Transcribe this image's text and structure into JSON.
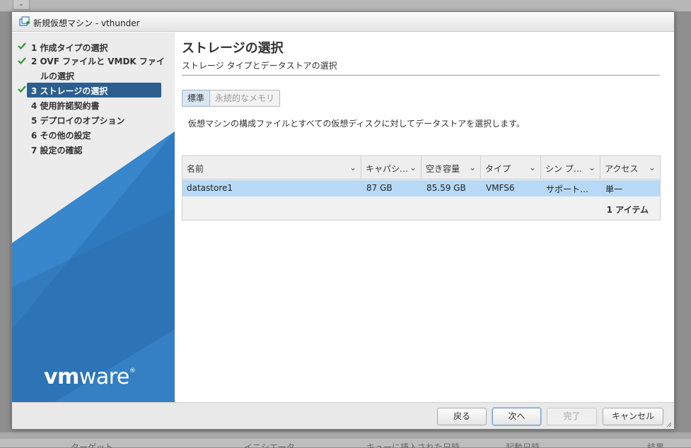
{
  "dialog": {
    "title": "新規仮想マシン - vthunder",
    "icon": "new-vm-icon"
  },
  "steps": [
    {
      "label": "1 作成タイプの選択",
      "done": true
    },
    {
      "label": "2 OVF ファイルと VMDK ファイ",
      "label2": "ルの選択",
      "done": true
    },
    {
      "label": "3 ストレージの選択",
      "done": true,
      "active": true
    },
    {
      "label": "4 使用許諾契約書"
    },
    {
      "label": "5 デプロイのオプション"
    },
    {
      "label": "6 その他の設定"
    },
    {
      "label": "7 設定の確認"
    }
  ],
  "brand": {
    "logo_vm": "vm",
    "logo_ware": "ware",
    "registered": "®"
  },
  "page": {
    "title": "ストレージの選択",
    "subtitle": "ストレージ タイプとデータストアの選択",
    "toggle": {
      "standard": "標準",
      "persistent": "永続的なメモリ",
      "selected": "標準"
    },
    "description": "仮想マシンの構成ファイルとすべての仮想ディスクに対してデータストアを選択します。"
  },
  "table": {
    "columns": [
      "名前",
      "キャパシ…",
      "空き容量",
      "タイプ",
      "シン プ…",
      "アクセス"
    ],
    "rows": [
      {
        "name": "datastore1",
        "capacity": "87 GB",
        "free": "85.59 GB",
        "type": "VMFS6",
        "thin": "サポート…",
        "access": "単一"
      }
    ],
    "count": "1 アイテム"
  },
  "buttons": {
    "back": "戻る",
    "next": "次へ",
    "finish": "完了",
    "cancel": "キャンセル"
  },
  "background_app": {
    "columns": [
      "ターゲット",
      "イニシエータ",
      "キューに挿入された日時",
      "起動日時",
      "結果"
    ]
  },
  "colors": {
    "accent": "#2d5f8e",
    "selection": "#b7d9f5",
    "check": "#2e9b2e"
  }
}
